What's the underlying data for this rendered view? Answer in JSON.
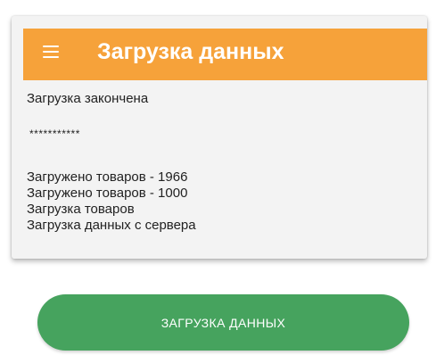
{
  "app_bar": {
    "title": "Загрузка данных",
    "menu_icon": "hamburger-menu-icon",
    "background_color": "#f6a23a"
  },
  "log": {
    "status": "Загрузка закончена",
    "separator": "***********",
    "lines": [
      "Загружено товаров - 1966",
      "Загружено товаров - 1000",
      "Загрузка товаров",
      "Загрузка данных с сервера"
    ]
  },
  "load_button": {
    "label": "ЗАГРУЗКА ДАННЫХ",
    "background_color": "#46a35e"
  }
}
